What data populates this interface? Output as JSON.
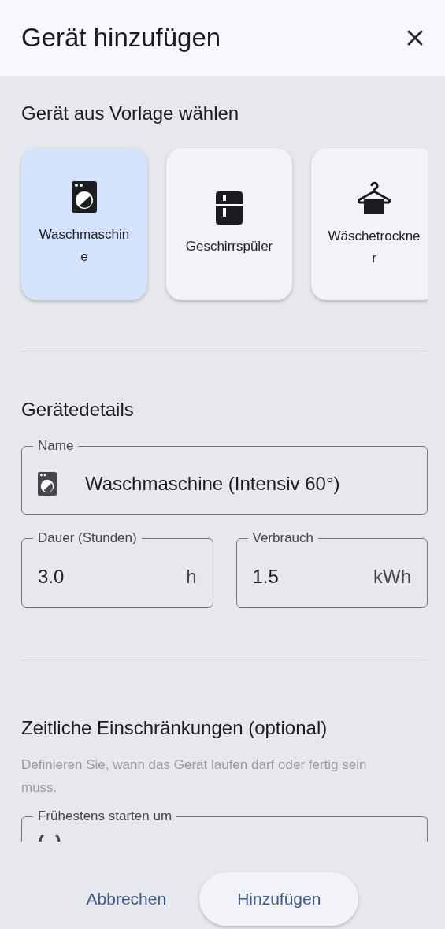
{
  "dialog": {
    "title": "Gerät hinzufügen"
  },
  "templates": {
    "heading": "Gerät aus Vorlage wählen",
    "items": [
      {
        "label": "Waschmaschine",
        "kind": "washer",
        "selected": true
      },
      {
        "label": "Geschirrspüler",
        "kind": "dishwasher",
        "selected": false
      },
      {
        "label": "Wäschetrockner",
        "kind": "dryer",
        "selected": false
      }
    ]
  },
  "details": {
    "heading": "Gerätedetails",
    "name_field": {
      "label": "Name",
      "value": "Waschmaschine (Intensiv 60°)",
      "kind": "washer"
    },
    "fields": [
      {
        "label": "Dauer (Stunden)",
        "value": "3.0",
        "unit": "h"
      },
      {
        "label": "Verbrauch",
        "value": "1.5",
        "unit": "kWh"
      }
    ]
  },
  "constraints": {
    "heading": "Zeitliche Einschränkungen (optional)",
    "description": "Definieren Sie, wann das Gerät laufen darf oder fertig sein muss.",
    "fields": [
      {
        "label": "Frühestens starten um",
        "kind": "time"
      }
    ]
  },
  "actions": [
    {
      "label": "Abbrechen",
      "kind": "text"
    },
    {
      "label": "Hinzufügen",
      "kind": "tonal"
    }
  ]
}
